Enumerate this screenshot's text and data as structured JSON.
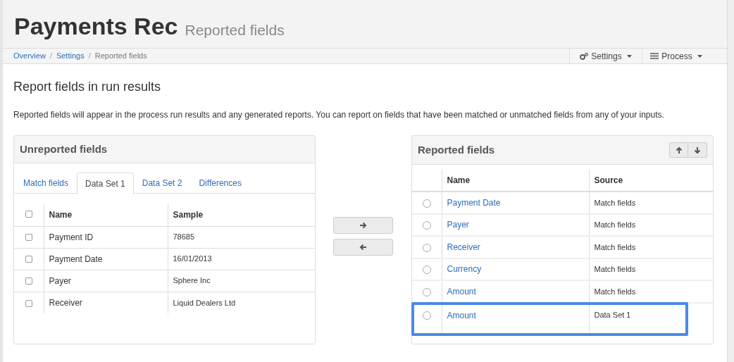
{
  "header": {
    "title": "Payments Rec",
    "subtitle": "Reported fields"
  },
  "breadcrumb": [
    {
      "label": "Overview",
      "link": true
    },
    {
      "separator": "/",
      "label": "Settings",
      "link": true
    },
    {
      "separator": "/",
      "label": "Reported fields",
      "link": false
    }
  ],
  "toolbar": [
    {
      "label": "Settings"
    },
    {
      "label": "Process"
    }
  ],
  "section_title": "Report fields in run results",
  "description": "Reported fields will appear in the process run results and any generated reports. You can report on fields that have been matched or unmatched fields from any of your inputs.",
  "unreported": {
    "title": "Unreported fields",
    "tabs": [
      {
        "label": "Match fields",
        "selected": false
      },
      {
        "label": "Data Set 1",
        "selected": true
      },
      {
        "label": "Data Set 2",
        "selected": false
      },
      {
        "label": "Differences",
        "selected": false
      }
    ],
    "columns": [
      "Name",
      "Sample"
    ],
    "all_checked": false,
    "rows": [
      {
        "name": "Payment ID",
        "sample": "78685",
        "checked": false
      },
      {
        "name": "Payment Date",
        "sample": "16/01/2013",
        "checked": false
      },
      {
        "name": "Payer",
        "sample": "Sphere Inc",
        "checked": false
      },
      {
        "name": "Receiver",
        "sample": "Liquid Dealers Ltd",
        "checked": false
      }
    ]
  },
  "reported": {
    "title": "Reported fields",
    "columns": [
      "Name",
      "Source"
    ],
    "rows": [
      {
        "name": "Payment Date",
        "source": "Match fields",
        "selected": false,
        "highlighted": false
      },
      {
        "name": "Payer",
        "source": "Match fields",
        "selected": false,
        "highlighted": false
      },
      {
        "name": "Receiver",
        "source": "Match fields",
        "selected": false,
        "highlighted": false
      },
      {
        "name": "Currency",
        "source": "Match fields",
        "selected": false,
        "highlighted": false
      },
      {
        "name": "Amount",
        "source": "Match fields",
        "selected": false,
        "highlighted": false
      },
      {
        "name": "Amount",
        "source": "Data Set 1",
        "selected": false,
        "highlighted": true
      }
    ]
  }
}
